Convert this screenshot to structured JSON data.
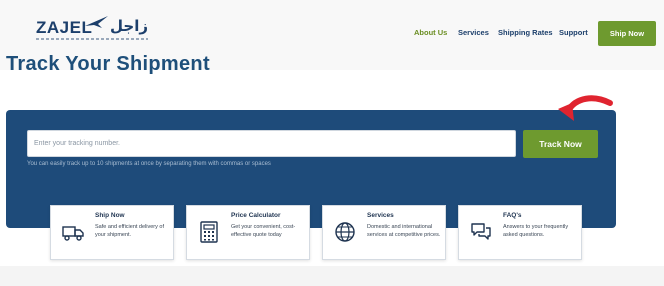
{
  "brand": {
    "name": "ZAJEL",
    "arabic": "زاجل"
  },
  "nav": {
    "about": "About Us",
    "services": "Services",
    "shipping_rates": "Shipping Rates",
    "support": "Support",
    "ship_now": "Ship Now"
  },
  "hero": {
    "title": "Track Your Shipment",
    "input_placeholder": "Enter your tracking number.",
    "track_button": "Track Now",
    "hint": "You can easily track up to 10 shipments at once by separating them with commas or spaces"
  },
  "cards": [
    {
      "title": "Ship Now",
      "desc": "Safe and efficient delivery of your shipment.",
      "icon": "truck-icon"
    },
    {
      "title": "Price Calculator",
      "desc": "Get your convenient, cost-effective quote today",
      "icon": "calculator-icon"
    },
    {
      "title": "Services",
      "desc": "Domestic and international services at competitive prices.",
      "icon": "globe-icon"
    },
    {
      "title": "FAQ's",
      "desc": "Answers to your frequently asked questions.",
      "icon": "chat-icon"
    }
  ],
  "colors": {
    "accent": "#6e9a2f",
    "panel": "#1e4b7a",
    "arrow": "#e0242f"
  }
}
